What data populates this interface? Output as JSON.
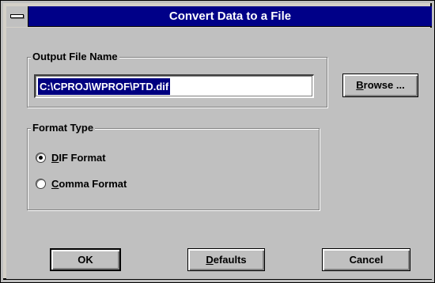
{
  "window": {
    "title": "Convert Data to a File"
  },
  "output_file": {
    "group_label": "Output File Name",
    "value": "C:\\CPROJ\\WPROF\\PTD.dif",
    "browse_label_mnemonic": "B",
    "browse_label_rest": "rowse ..."
  },
  "format_type": {
    "group_label": "Format Type",
    "options": [
      {
        "mnemonic": "D",
        "rest": "IF Format",
        "selected": true
      },
      {
        "mnemonic": "C",
        "rest": "omma Format",
        "selected": false
      }
    ]
  },
  "buttons": {
    "ok": "OK",
    "defaults_mnemonic": "D",
    "defaults_rest": "efaults",
    "cancel": "Cancel"
  },
  "colors": {
    "titlebar": "#000088",
    "face": "#c0c0c0",
    "selection": "#000080"
  }
}
